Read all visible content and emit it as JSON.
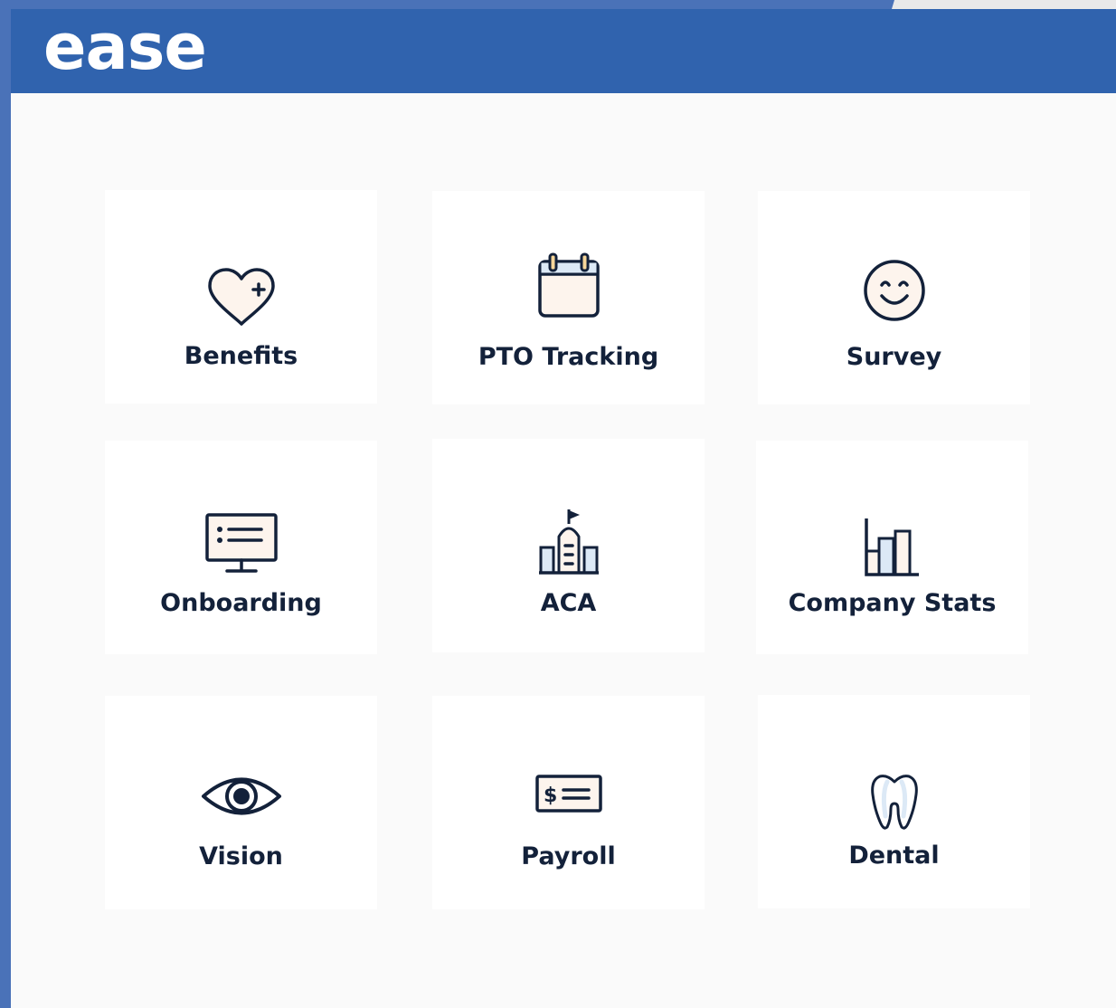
{
  "app": {
    "logo_text": "ease",
    "brand_color": "#3063ae",
    "text_color": "#13213a"
  },
  "tiles": [
    {
      "label": "Benefits",
      "icon": "heart-plus-icon"
    },
    {
      "label": "PTO Tracking",
      "icon": "calendar-icon"
    },
    {
      "label": "Survey",
      "icon": "smiley-icon"
    },
    {
      "label": "Onboarding",
      "icon": "monitor-list-icon"
    },
    {
      "label": "ACA",
      "icon": "capitol-building-icon"
    },
    {
      "label": "Company Stats",
      "icon": "bar-chart-icon"
    },
    {
      "label": "Vision",
      "icon": "eye-icon"
    },
    {
      "label": "Payroll",
      "icon": "check-dollar-icon"
    },
    {
      "label": "Dental",
      "icon": "tooth-icon"
    }
  ]
}
